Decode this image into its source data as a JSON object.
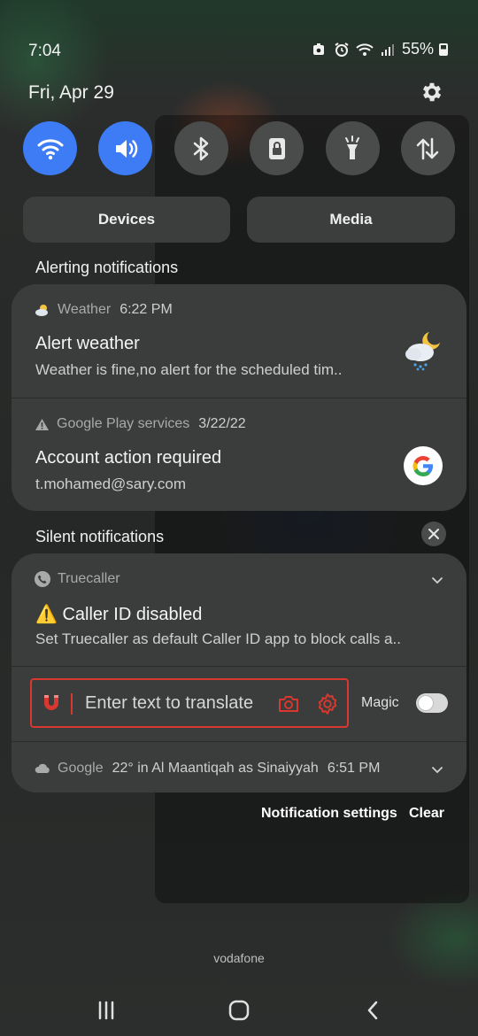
{
  "status_bar": {
    "time": "7:04",
    "battery": "55%"
  },
  "header": {
    "date": "Fri, Apr 29"
  },
  "quick_settings": [
    {
      "name": "wifi",
      "icon": "wifi-icon",
      "active": true
    },
    {
      "name": "sound",
      "icon": "speaker-icon",
      "active": true
    },
    {
      "name": "bluetooth",
      "icon": "bluetooth-icon",
      "active": false
    },
    {
      "name": "screen-lock",
      "icon": "lock-icon",
      "active": false
    },
    {
      "name": "flashlight",
      "icon": "flashlight-icon",
      "active": false
    },
    {
      "name": "mobile-data",
      "icon": "data-arrows-icon",
      "active": false
    }
  ],
  "segments": {
    "devices": "Devices",
    "media": "Media"
  },
  "alerting": {
    "title": "Alerting notifications",
    "items": [
      {
        "app": "Weather",
        "time": "6:22 PM",
        "title": "Alert weather",
        "body": "Weather is fine,no alert for the scheduled tim.."
      },
      {
        "app": "Google Play services",
        "time": "3/22/22",
        "title": "Account action required",
        "body": "t.mohamed@sary.com"
      }
    ]
  },
  "silent": {
    "title": "Silent notifications",
    "truecaller": {
      "app": "Truecaller",
      "title": "Caller ID disabled",
      "warning": "⚠️",
      "body": "Set Truecaller as default Caller ID app to block calls a.."
    },
    "translate": {
      "placeholder": "Enter text to translate",
      "magic_label": "Magic",
      "magic_on": false
    },
    "google": {
      "app": "Google",
      "body": "22° in Al Maantiqah as Sinaiyyah",
      "time": "6:51 PM"
    }
  },
  "footer": {
    "settings": "Notification settings",
    "clear": "Clear"
  },
  "carrier": "vodafone",
  "colors": {
    "accent": "#3d7cf4",
    "translate_red": "#d8382f"
  }
}
